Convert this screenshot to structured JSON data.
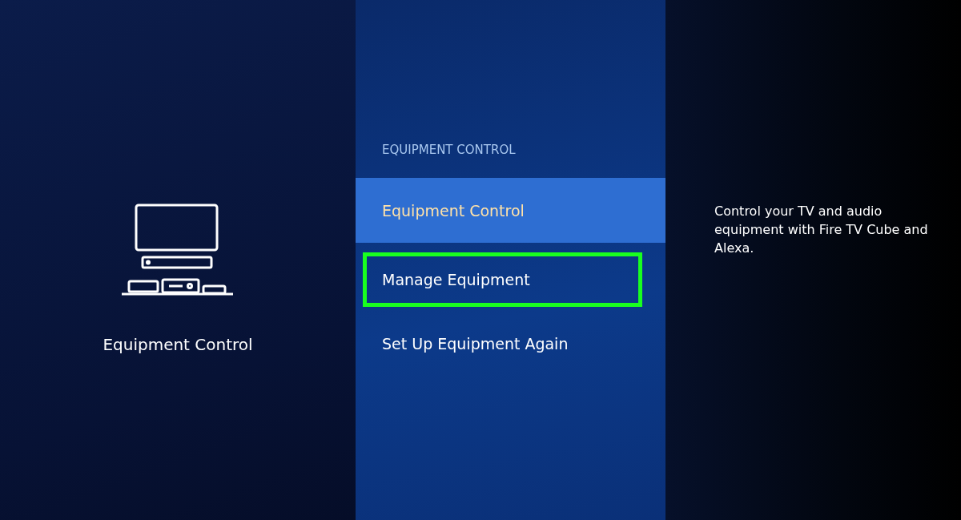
{
  "category": {
    "title": "Equipment Control"
  },
  "menu": {
    "heading": "EQUIPMENT CONTROL",
    "items": [
      {
        "label": "Equipment Control",
        "selected": true,
        "annotated": false
      },
      {
        "label": "Manage Equipment",
        "selected": false,
        "annotated": true
      },
      {
        "label": "Set Up Equipment Again",
        "selected": false,
        "annotated": false
      }
    ]
  },
  "description": "Control your TV and audio equipment with Fire TV Cube and Alexa."
}
